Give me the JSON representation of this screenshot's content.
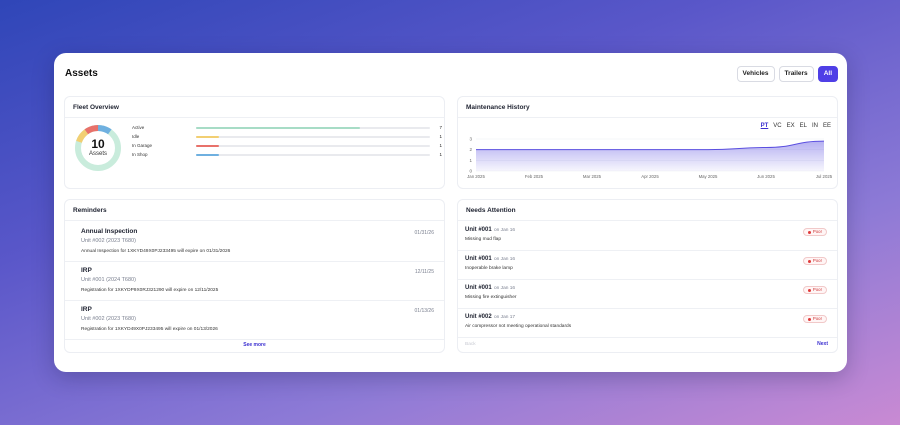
{
  "header": {
    "title": "Assets",
    "filters": [
      "Vehicles",
      "Trailers",
      "All"
    ],
    "active_filter": "All"
  },
  "fleet_overview": {
    "title": "Fleet Overview",
    "total": "10",
    "total_label": "Assets",
    "stats": [
      {
        "label": "Active",
        "value": 7,
        "color": "#7fcfae"
      },
      {
        "label": "Idle",
        "value": 1,
        "color": "#f2cf72"
      },
      {
        "label": "In Garage",
        "value": 1,
        "color": "#e8716a"
      },
      {
        "label": "In Shop",
        "value": 1,
        "color": "#6fb0e0"
      }
    ]
  },
  "maintenance_history": {
    "title": "Maintenance History",
    "tabs": [
      "PT",
      "VC",
      "EX",
      "EL",
      "IN",
      "EE"
    ],
    "active_tab": "PT"
  },
  "chart_data": {
    "type": "area",
    "x": [
      "Jan 2025",
      "Feb 2025",
      "Mar 2025",
      "Apr 2025",
      "May 2025",
      "Jun 2025",
      "Jul 2025"
    ],
    "values": [
      2,
      2,
      2,
      2,
      2,
      2.2,
      2.8
    ],
    "ylim": [
      0,
      3
    ],
    "yticks": [
      "0",
      "1",
      "2",
      "3"
    ],
    "grid": true,
    "color": "#5b4fe0"
  },
  "reminders": {
    "title": "Reminders",
    "items": [
      {
        "title": "Annual Inspection",
        "unit": "Unit #002 (2023 T680)",
        "desc": "Annual Inspection for 1XKYD49X0PJ233495 will expire on 01/31/2026",
        "date": "01/31/26"
      },
      {
        "title": "IRP",
        "unit": "Unit #001 (2024 T680)",
        "desc": "Registration for 1XKYDP9X0RJ321290 will expire on 12/11/2025",
        "date": "12/11/25"
      },
      {
        "title": "IRP",
        "unit": "Unit #002 (2023 T680)",
        "desc": "Registration for 1XKYD49X0PJ233495 will expire on 01/13/2026",
        "date": "01/13/26"
      }
    ],
    "see_more": "See more"
  },
  "needs_attention": {
    "title": "Needs Attention",
    "items": [
      {
        "unit": "Unit #001",
        "date": "on Jan 16",
        "desc": "Missing mud flap",
        "status": "Poor"
      },
      {
        "unit": "Unit #001",
        "date": "on Jan 16",
        "desc": "Inoperable brake lamp",
        "status": "Poor"
      },
      {
        "unit": "Unit #001",
        "date": "on Jan 16",
        "desc": "Missing fire extinguisher",
        "status": "Poor"
      },
      {
        "unit": "Unit #002",
        "date": "on Jan 17",
        "desc": "Air compressor not meeting operational standards",
        "status": "Poor"
      }
    ],
    "back": "Back",
    "next": "Next"
  }
}
